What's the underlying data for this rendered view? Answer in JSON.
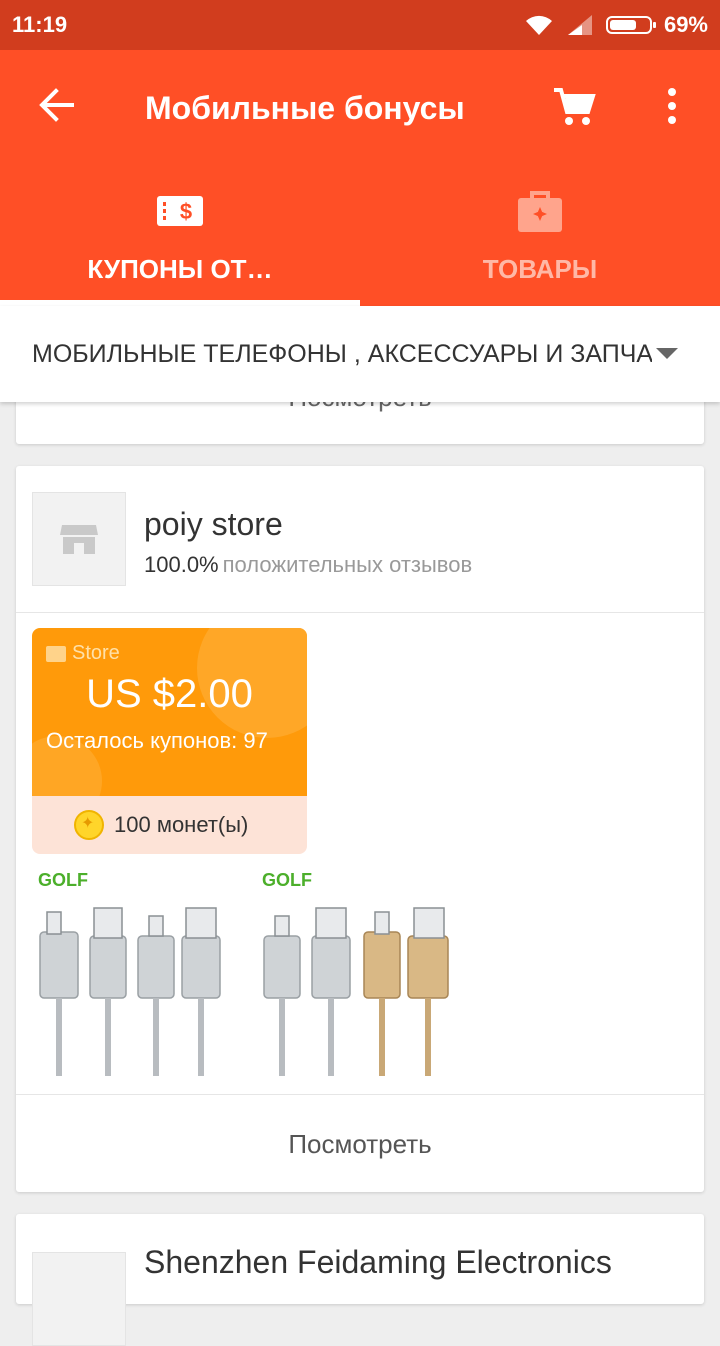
{
  "status_bar": {
    "time": "11:19",
    "battery_text": "69%",
    "battery_level": 0.69,
    "icons": [
      "wifi-icon",
      "signal-icon",
      "battery-icon"
    ]
  },
  "app_bar": {
    "title": "Мобильные бонусы",
    "back_icon": "arrow-left-icon",
    "cart_icon": "cart-icon",
    "more_icon": "more-vert-icon",
    "color": "#ff4f26"
  },
  "tabs": [
    {
      "label": "КУПОНЫ ОТ…",
      "icon": "coupon-icon",
      "active": true
    },
    {
      "label": "ТОВАРЫ",
      "icon": "bag-icon",
      "active": false
    }
  ],
  "category": {
    "selected": "МОБИЛЬНЫЕ ТЕЛЕФОНЫ , АКСЕССУАРЫ И ЗАПЧАСТИ"
  },
  "prev_card": {
    "view_label": "Посмотреть"
  },
  "store_card": {
    "store_name": "poiy store",
    "rating_pct": "100.0%",
    "rating_label": "положительных отзывов",
    "coupon": {
      "tag": "Store",
      "amount": "US $2.00",
      "remaining": "Осталось купонов: 97",
      "coins": "100 монет(ы)",
      "color": "#ff9a0a"
    },
    "products": [
      {
        "brand": "GOLF"
      },
      {
        "brand": "GOLF"
      }
    ],
    "view_label": "Посмотреть"
  },
  "next_card": {
    "store_name": "Shenzhen Feidaming Electronics"
  }
}
